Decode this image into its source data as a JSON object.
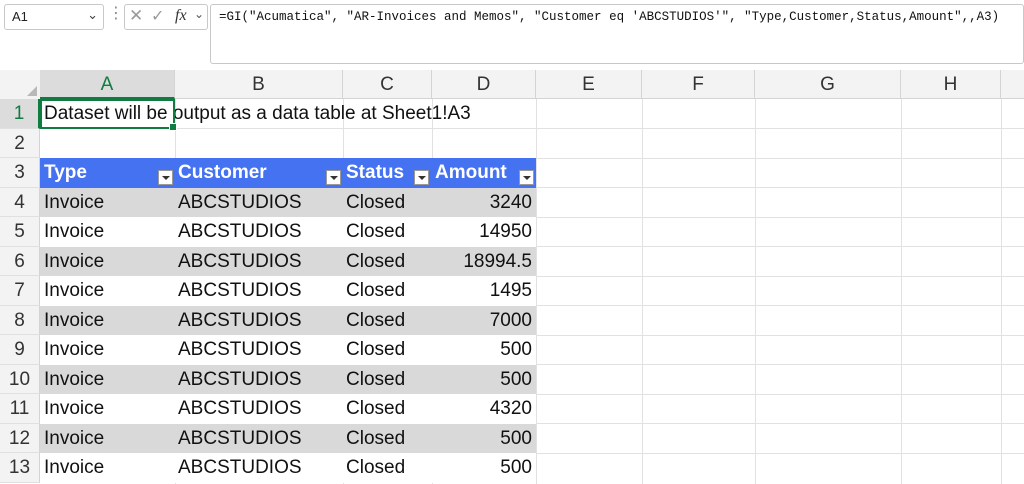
{
  "formula_bar": {
    "name_box": "A1",
    "formula": "=GI(\"Acumatica\", \"AR-Invoices and Memos\", \"Customer eq 'ABCSTUDIOS'\", \"Type,Customer,Status,Amount\",,A3)"
  },
  "columns": [
    "A",
    "B",
    "C",
    "D",
    "E",
    "F",
    "G",
    "H"
  ],
  "rows": [
    "1",
    "2",
    "3",
    "4",
    "5",
    "6",
    "7",
    "8",
    "9",
    "10",
    "11",
    "12",
    "13"
  ],
  "cell_a1": "Dataset will be output as a data table at Sheet1!A3",
  "table": {
    "headers": [
      "Type",
      "Customer",
      "Status",
      "Amount"
    ],
    "rows": [
      [
        "Invoice",
        "ABCSTUDIOS",
        "Closed",
        "3240"
      ],
      [
        "Invoice",
        "ABCSTUDIOS",
        "Closed",
        "14950"
      ],
      [
        "Invoice",
        "ABCSTUDIOS",
        "Closed",
        "18994.5"
      ],
      [
        "Invoice",
        "ABCSTUDIOS",
        "Closed",
        "1495"
      ],
      [
        "Invoice",
        "ABCSTUDIOS",
        "Closed",
        "7000"
      ],
      [
        "Invoice",
        "ABCSTUDIOS",
        "Closed",
        "500"
      ],
      [
        "Invoice",
        "ABCSTUDIOS",
        "Closed",
        "500"
      ],
      [
        "Invoice",
        "ABCSTUDIOS",
        "Closed",
        "4320"
      ],
      [
        "Invoice",
        "ABCSTUDIOS",
        "Closed",
        "500"
      ],
      [
        "Invoice",
        "ABCSTUDIOS",
        "Closed",
        "500"
      ]
    ]
  },
  "colors": {
    "table_header": "#4472f0",
    "band": "#d9d9d9",
    "selection": "#107c41"
  },
  "icons": {
    "name_box_dropdown": "chevron-down-icon",
    "cancel": "close-icon",
    "enter": "check-icon",
    "function": "fx-icon"
  }
}
